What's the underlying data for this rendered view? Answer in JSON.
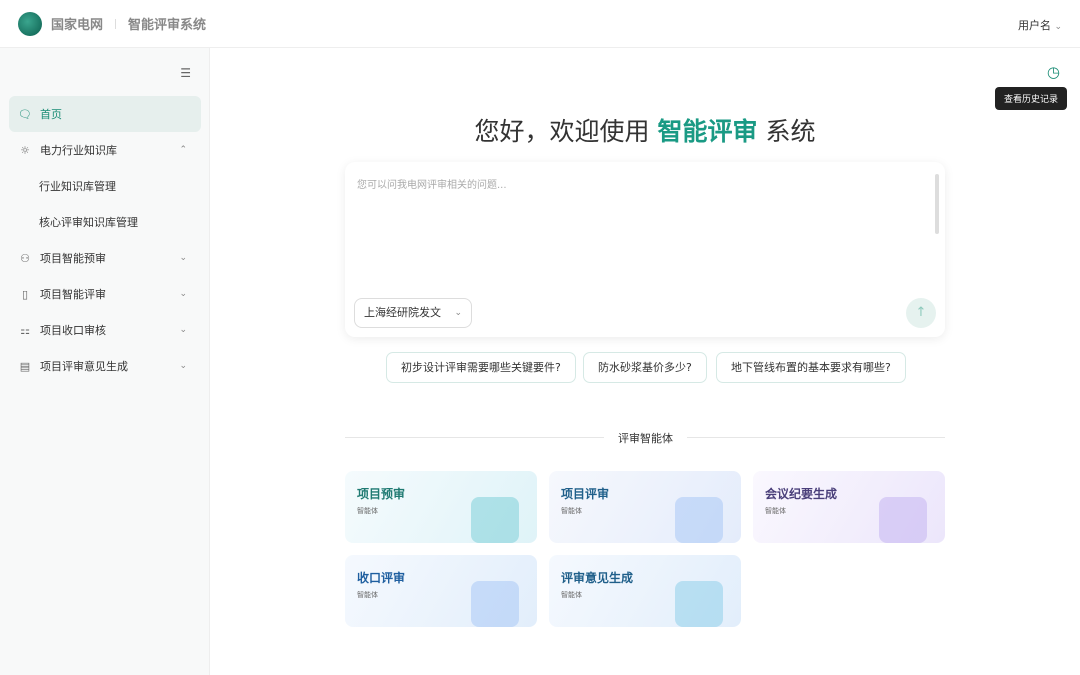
{
  "header": {
    "brand": "国家电网",
    "system": "智能评审系统",
    "user": "用户名"
  },
  "sidebar": {
    "items": [
      {
        "label": "首页",
        "icon": "chat-icon",
        "active": true
      },
      {
        "label": "电力行业知识库",
        "icon": "bulb-icon",
        "chev": "⌃"
      },
      {
        "label": "行业知识库管理",
        "sub": true
      },
      {
        "label": "核心评审知识库管理",
        "sub": true
      },
      {
        "label": "项目智能预审",
        "icon": "review-icon",
        "chev": "⌄"
      },
      {
        "label": "项目智能评审",
        "icon": "book-icon",
        "chev": "⌄"
      },
      {
        "label": "项目收口审核",
        "icon": "org-icon",
        "chev": "⌄"
      },
      {
        "label": "项目评审意见生成",
        "icon": "doc-icon",
        "chev": "⌄"
      }
    ]
  },
  "history": {
    "tooltip": "查看历史记录"
  },
  "main": {
    "title_pre": "您好，欢迎使用 ",
    "title_hl": "智能评审",
    "title_post": " 系统",
    "placeholder": "您可以问我电网评审相关的问题...",
    "select": "上海经研院发文",
    "suggestions": [
      "初步设计评审需要哪些关键要件?",
      "防水砂浆基价多少?",
      "地下管线布置的基本要求有哪些?"
    ],
    "section": "评审智能体",
    "cards": [
      {
        "name": "项目预审",
        "sub": "智能体",
        "color": "#1f7a72"
      },
      {
        "name": "项目评审",
        "sub": "智能体",
        "color": "#1f5f8a"
      },
      {
        "name": "会议纪要生成",
        "sub": "智能体",
        "color": "#4a3f7a"
      },
      {
        "name": "收口评审",
        "sub": "智能体",
        "color": "#1f5fa0"
      },
      {
        "name": "评审意见生成",
        "sub": "智能体",
        "color": "#1f5f8a"
      }
    ]
  }
}
